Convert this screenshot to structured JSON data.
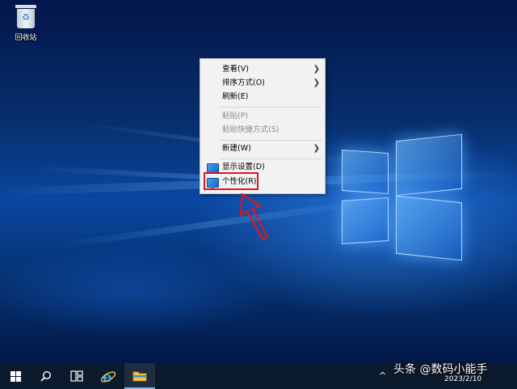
{
  "desktop": {
    "recycle_bin_label": "回收站"
  },
  "context_menu": {
    "items": [
      {
        "label": "查看(V)",
        "has_submenu": true,
        "disabled": false
      },
      {
        "label": "排序方式(O)",
        "has_submenu": true,
        "disabled": false
      },
      {
        "label": "刷新(E)",
        "has_submenu": false,
        "disabled": false
      },
      {
        "label": "粘贴(P)",
        "has_submenu": false,
        "disabled": true
      },
      {
        "label": "粘贴快捷方式(S)",
        "has_submenu": false,
        "disabled": true
      },
      {
        "label": "新建(W)",
        "has_submenu": true,
        "disabled": false
      },
      {
        "label": "显示设置(D)",
        "has_submenu": false,
        "disabled": false,
        "icon": "display-icon"
      },
      {
        "label": "个性化(R)",
        "has_submenu": false,
        "disabled": false,
        "icon": "personalize-icon",
        "highlighted": true
      }
    ],
    "highlight_color": "#e0161c"
  },
  "taskbar": {
    "buttons": [
      "windows-start-icon",
      "search-icon",
      "task-view-icon",
      "ie-icon",
      "file-explorer-icon"
    ],
    "tray_chevron": "^",
    "date": "2023/2/10"
  },
  "watermark": "头条 @数码小能手"
}
